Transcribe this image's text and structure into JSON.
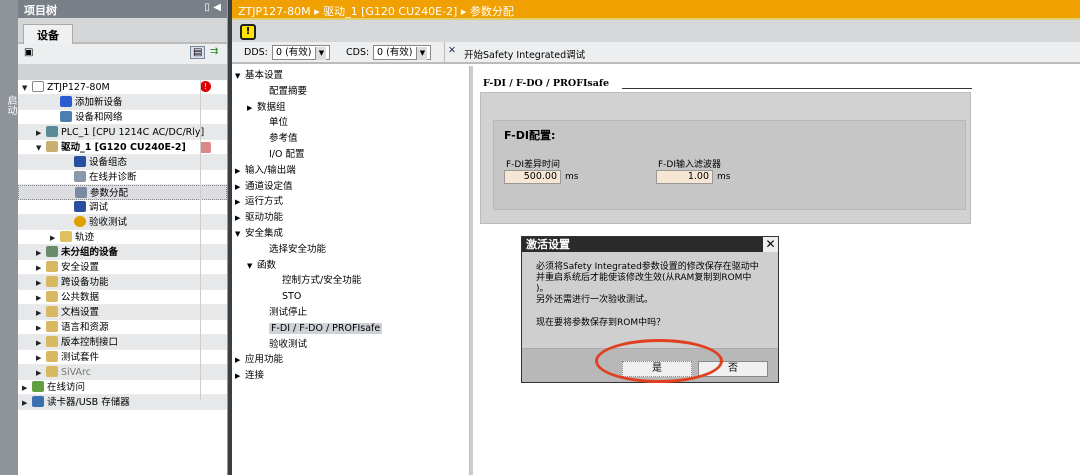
{
  "side_strip": {
    "label": "启动"
  },
  "tree": {
    "title": "项目树",
    "tab": "设备",
    "items": [
      {
        "label": "ZTJP127-80M",
        "indent": 0,
        "tw": "▼",
        "icon": "project-icon",
        "error": true
      },
      {
        "label": "添加新设备",
        "indent": 2,
        "tw": "",
        "icon": "add-device-icon"
      },
      {
        "label": "设备和网络",
        "indent": 2,
        "tw": "",
        "icon": "network-icon"
      },
      {
        "label": "PLC_1 [CPU 1214C AC/DC/Rly]",
        "indent": 1,
        "tw": "▶",
        "icon": "plc-icon",
        "bold": false
      },
      {
        "label": "驱动_1 [G120 CU240E-2]",
        "indent": 1,
        "tw": "▼",
        "icon": "drive-icon",
        "bold": true,
        "drive_flag": true
      },
      {
        "label": "设备组态",
        "indent": 3,
        "tw": "",
        "icon": "device-config-icon"
      },
      {
        "label": "在线并诊断",
        "indent": 3,
        "tw": "",
        "icon": "online-diag-icon"
      },
      {
        "label": "参数分配",
        "indent": 3,
        "tw": "",
        "icon": "parameter-icon",
        "selected": true
      },
      {
        "label": "调试",
        "indent": 3,
        "tw": "",
        "icon": "commissioning-icon"
      },
      {
        "label": "验收测试",
        "indent": 3,
        "tw": "",
        "icon": "acceptance-test-icon"
      },
      {
        "label": "轨迹",
        "indent": 2,
        "tw": "▶",
        "icon": "trace-folder-icon"
      },
      {
        "label": "未分组的设备",
        "indent": 1,
        "tw": "▶",
        "icon": "ungrouped-icon",
        "bold": true
      },
      {
        "label": "安全设置",
        "indent": 1,
        "tw": "▶",
        "icon": "security-icon"
      },
      {
        "label": "跨设备功能",
        "indent": 1,
        "tw": "▶",
        "icon": "cross-device-icon"
      },
      {
        "label": "公共数据",
        "indent": 1,
        "tw": "▶",
        "icon": "common-data-icon"
      },
      {
        "label": "文档设置",
        "indent": 1,
        "tw": "▶",
        "icon": "doc-settings-icon"
      },
      {
        "label": "语言和资源",
        "indent": 1,
        "tw": "▶",
        "icon": "language-icon"
      },
      {
        "label": "版本控制接口",
        "indent": 1,
        "tw": "▶",
        "icon": "version-control-icon"
      },
      {
        "label": "测试套件",
        "indent": 1,
        "tw": "▶",
        "icon": "test-suite-icon"
      },
      {
        "label": "SiVArc",
        "indent": 1,
        "tw": "▶",
        "icon": "sivarc-icon",
        "grey": true
      },
      {
        "label": "在线访问",
        "indent": 0,
        "tw": "▶",
        "icon": "online-access-icon"
      },
      {
        "label": "读卡器/USB 存储器",
        "indent": 0,
        "tw": "▶",
        "icon": "card-reader-icon"
      }
    ]
  },
  "breadcrumb": [
    "ZTJP127-80M",
    "驱动_1 [G120 CU240E-2]",
    "参数分配"
  ],
  "toolbar": {
    "dds_label": "DDS:",
    "dds_value": "0 (有效)",
    "cds_label": "CDS:",
    "cds_value": "0 (有效)",
    "start_label": "开始Safety  Integrated调试"
  },
  "nav": [
    {
      "label": "基本设置",
      "indent": 0,
      "tw": "▼"
    },
    {
      "label": "配置摘要",
      "indent": 1,
      "tw": ""
    },
    {
      "label": "数据组",
      "indent": 1,
      "tw": "▶"
    },
    {
      "label": "单位",
      "indent": 1,
      "tw": ""
    },
    {
      "label": "参考值",
      "indent": 1,
      "tw": ""
    },
    {
      "label": "I/O 配置",
      "indent": 1,
      "tw": ""
    },
    {
      "label": "输入/输出端",
      "indent": 0,
      "tw": "▶"
    },
    {
      "label": "通道设定值",
      "indent": 0,
      "tw": "▶"
    },
    {
      "label": "运行方式",
      "indent": 0,
      "tw": "▶"
    },
    {
      "label": "驱动功能",
      "indent": 0,
      "tw": "▶"
    },
    {
      "label": "安全集成",
      "indent": 0,
      "tw": "▼"
    },
    {
      "label": "选择安全功能",
      "indent": 1,
      "tw": ""
    },
    {
      "label": "函数",
      "indent": 1,
      "tw": "▼"
    },
    {
      "label": "控制方式/安全功能",
      "indent": 2,
      "tw": ""
    },
    {
      "label": "STO",
      "indent": 2,
      "tw": ""
    },
    {
      "label": "测试停止",
      "indent": 1,
      "tw": ""
    },
    {
      "label": "F-DI / F-DO / PROFIsafe",
      "indent": 1,
      "tw": "",
      "active": true
    },
    {
      "label": "验收测试",
      "indent": 1,
      "tw": ""
    },
    {
      "label": "应用功能",
      "indent": 0,
      "tw": "▶"
    },
    {
      "label": "连接",
      "indent": 0,
      "tw": "▶"
    }
  ],
  "content": {
    "section_title": "F-DI / F-DO / PROFIsafe",
    "group_title": "F-DI配置:",
    "fields": [
      {
        "label": "F-DI差异时间",
        "value": "500.00",
        "unit": "ms"
      },
      {
        "label": "F-DI输入滤波器",
        "value": "1.00",
        "unit": "ms"
      }
    ]
  },
  "dialog": {
    "title": "激活设置",
    "lines": [
      "必须将Safety Integrated参数设置的修改保存在驱动中",
      "并重启系统后才能使该修改生效(从RAM复制到ROM中",
      ")。",
      "另外还需进行一次验收测试。"
    ],
    "question": "现在要将参数保存到ROM中吗？",
    "yes": "是",
    "no": "否"
  },
  "colors": {
    "accent": "#f0a000",
    "highlight_circle": "#e04020"
  }
}
